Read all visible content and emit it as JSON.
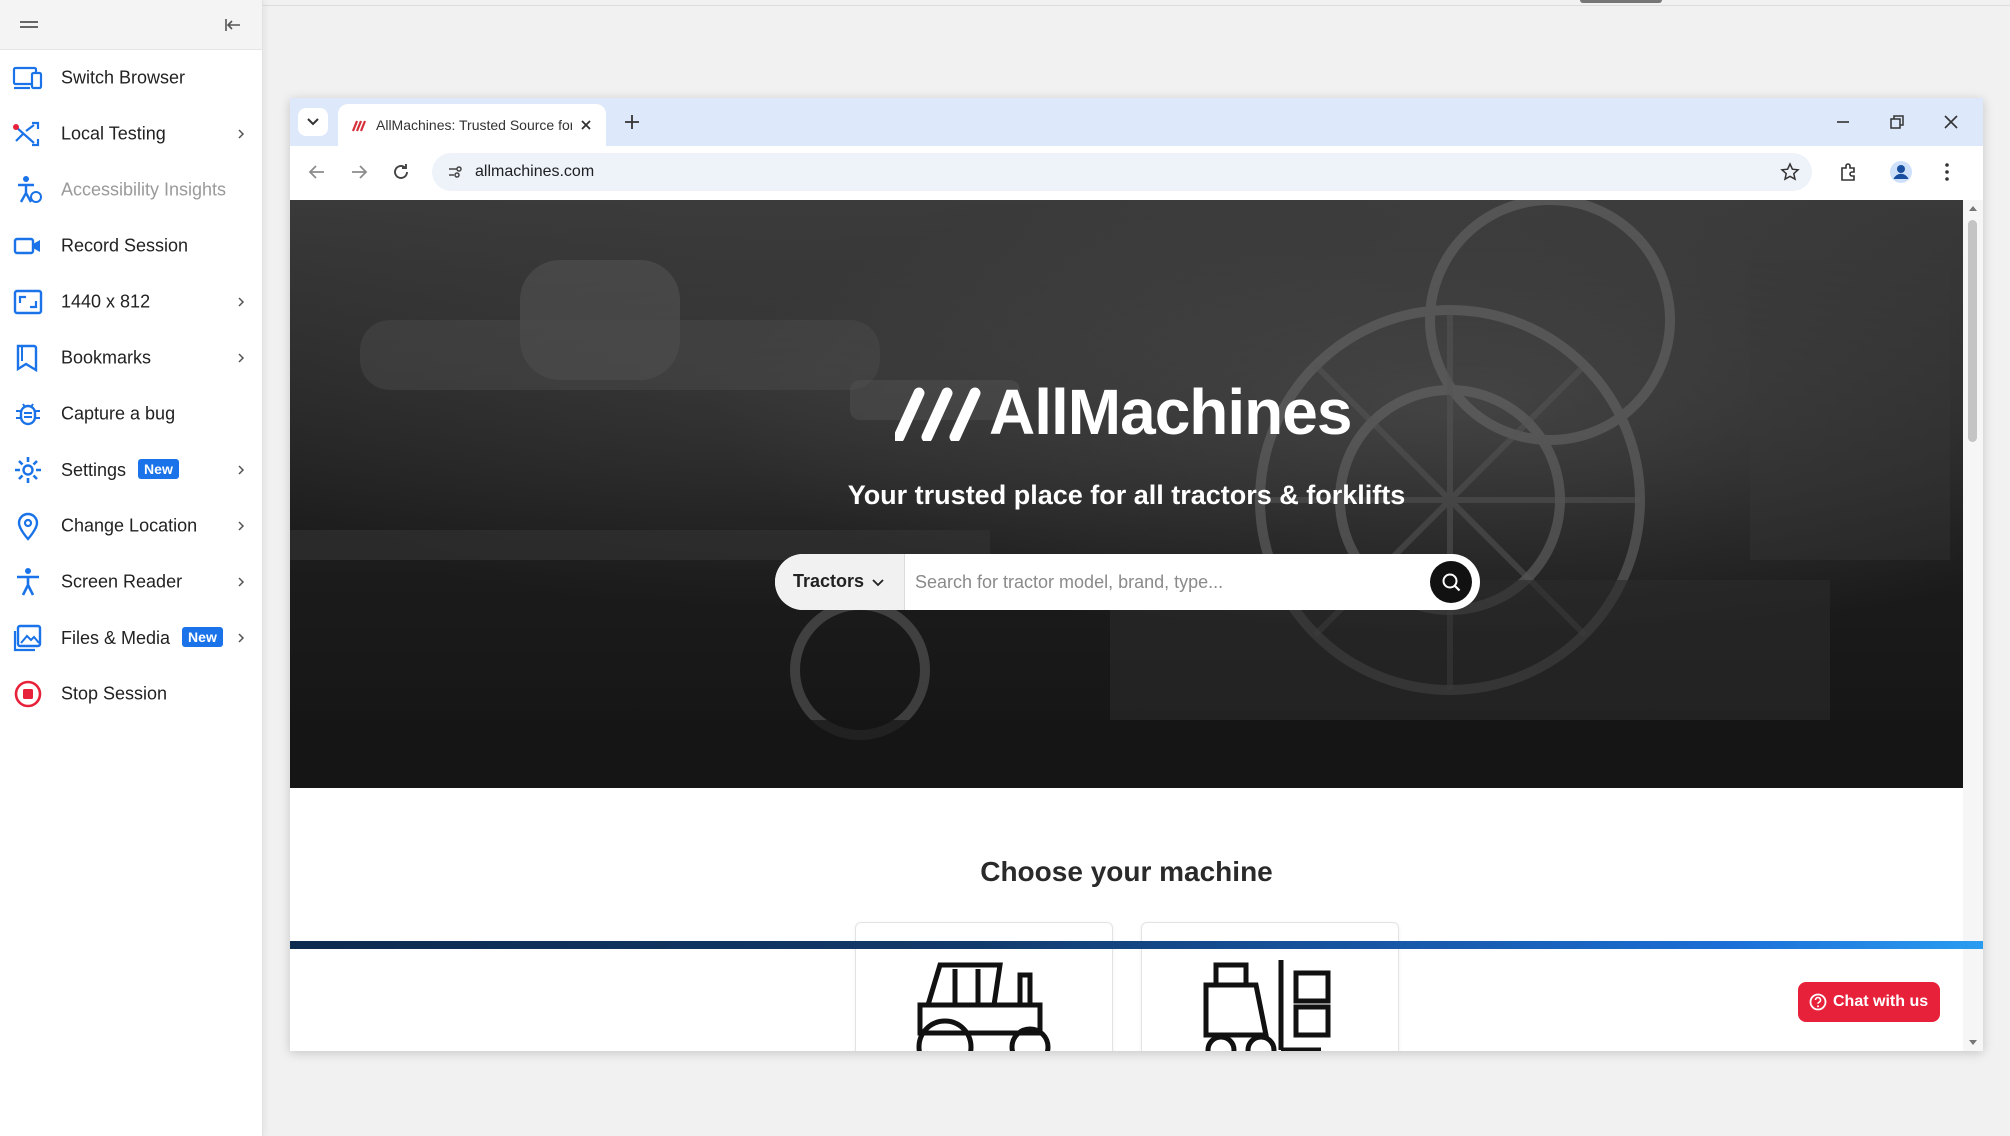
{
  "sidebar": {
    "items": [
      {
        "label": "Switch Browser"
      },
      {
        "label": "Local Testing"
      },
      {
        "label": "Accessibility Insights"
      },
      {
        "label": "Record Session"
      },
      {
        "label": "1440 x 812"
      },
      {
        "label": "Bookmarks"
      },
      {
        "label": "Capture a bug"
      },
      {
        "label": "Settings",
        "badge": "New"
      },
      {
        "label": "Change Location"
      },
      {
        "label": "Screen Reader"
      },
      {
        "label": "Files & Media",
        "badge": "New"
      },
      {
        "label": "Stop Session"
      }
    ]
  },
  "browser": {
    "tab_title": "AllMachines: Trusted Source for",
    "url": "allmachines.com"
  },
  "page": {
    "brand": "AllMachines",
    "tagline": "Your trusted place for all tractors & forklifts",
    "search": {
      "category": "Tractors",
      "placeholder": "Search for tractor model, brand, type..."
    },
    "section_title": "Choose your machine",
    "chat_label": "Chat with us"
  },
  "colors": {
    "accent": "#1a73e8",
    "chat": "#e8213a",
    "tabstrip": "#dde8fb"
  }
}
